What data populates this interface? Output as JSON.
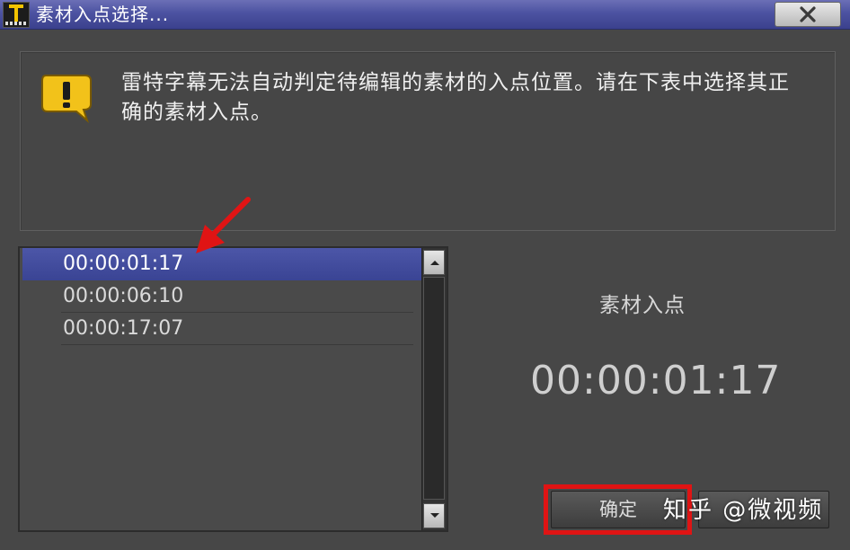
{
  "window": {
    "title": "素材入点选择...",
    "close_label": "close"
  },
  "message": {
    "text_line1": "雷特字幕无法自动判定待编辑的素材的入点位置。请在下表中选择其正",
    "text_line2": "确的素材入点。"
  },
  "list": {
    "items": [
      {
        "label": "00:00:01:17",
        "selected": true
      },
      {
        "label": "00:00:06:10",
        "selected": false
      },
      {
        "label": "00:00:17:07",
        "selected": false
      }
    ]
  },
  "detail": {
    "label": "素材入点",
    "timecode": "00:00:01:17"
  },
  "buttons": {
    "ok_label": "确定",
    "cancel_label": ""
  },
  "watermark": "知乎 @微视频",
  "colors": {
    "title_bar": "#4c52a1",
    "selection": "#3f4a9c",
    "highlight_box": "#e01414",
    "annotation_arrow": "#e01414"
  }
}
